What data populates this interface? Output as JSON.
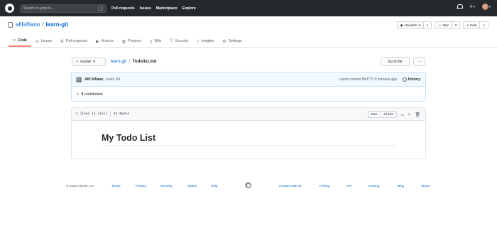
{
  "header": {
    "search_placeholder": "Search or jump to...",
    "search_shortcut": "/",
    "nav": [
      "Pull requests",
      "Issues",
      "Marketplace",
      "Explore"
    ]
  },
  "repo": {
    "owner": "afifalfiano",
    "separator": "/",
    "name": "learn-git",
    "watch": {
      "label": "Unwatch",
      "count": "1"
    },
    "star": {
      "label": "Star",
      "count": "0"
    },
    "fork": {
      "label": "Fork",
      "count": "1"
    }
  },
  "tabs": [
    {
      "label": "Code",
      "icon": "code-icon"
    },
    {
      "label": "Issues",
      "icon": "issue-icon"
    },
    {
      "label": "Pull requests",
      "icon": "pull-request-icon"
    },
    {
      "label": "Actions",
      "icon": "play-icon"
    },
    {
      "label": "Projects",
      "icon": "project-icon"
    },
    {
      "label": "Wiki",
      "icon": "book-icon"
    },
    {
      "label": "Security",
      "icon": "shield-icon"
    },
    {
      "label": "Insights",
      "icon": "graph-icon"
    },
    {
      "label": "Settings",
      "icon": "gear-icon"
    }
  ],
  "filenav": {
    "branch": "master",
    "repo_link": "learn-git",
    "separator": "/",
    "file": "Todolist.md",
    "goto": "Go to file",
    "more": "···"
  },
  "commit": {
    "author": "Afif Alfiano",
    "message": "Learn Git",
    "meta_prefix": "Latest commit",
    "sha": "f8ef775",
    "time": "9 minutes ago",
    "history": "History",
    "contributors_count": "0",
    "contributors_label": "contributors"
  },
  "file": {
    "lines": "1 lines (1 sloc)",
    "size": "14 Bytes",
    "raw": "Raw",
    "blame": "Blame",
    "heading": "My Todo List"
  },
  "footer": {
    "copyright": "© 2020 GitHub, Inc.",
    "links": [
      "Terms",
      "Privacy",
      "Security",
      "Status",
      "Help",
      "Contact GitHub",
      "Pricing",
      "API",
      "Training",
      "Blog",
      "About"
    ]
  },
  "colors": {
    "header_bg": "#24292e",
    "link": "#0366d6",
    "active_tab_underline": "#f9826c",
    "commit_bg": "#f1f8ff"
  }
}
